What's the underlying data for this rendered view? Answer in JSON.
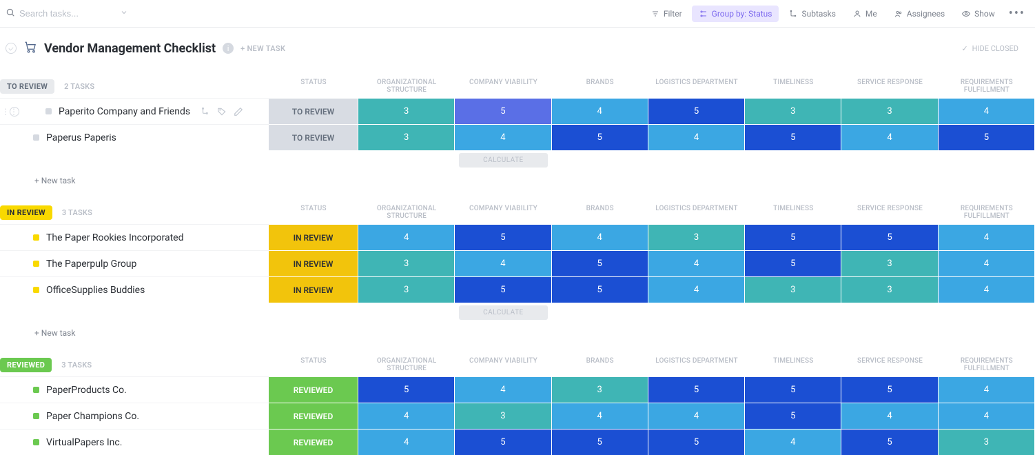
{
  "search": {
    "placeholder": "Search tasks..."
  },
  "toolbar": {
    "filter": "Filter",
    "group_by": "Group by: Status",
    "subtasks": "Subtasks",
    "me": "Me",
    "assignees": "Assignees",
    "show": "Show"
  },
  "list": {
    "title": "Vendor Management Checklist",
    "new_task_header": "+ NEW TASK",
    "hide_closed": "HIDE CLOSED"
  },
  "columns": {
    "status": "STATUS",
    "org": "ORGANIZATIONAL STRUCTURE",
    "viability": "COMPANY VIABILITY",
    "brands": "BRANDS",
    "logistics": "LOGISTICS DEPARTMENT",
    "timeliness": "TIMELINESS",
    "service": "SERVICE RESPONSE",
    "requirements": "REQUIREMENTS FULFILLMENT"
  },
  "calc_label": "CALCULATE",
  "new_task_label": "+ New task",
  "groups": [
    {
      "id": "to_review",
      "label": "TO REVIEW",
      "count": "2 TASKS",
      "pill_class": "pill-gray",
      "collapse_class": "",
      "status_class": "st-gray",
      "dot_class": "dot-gray",
      "show_calc": true,
      "show_new_task": true,
      "tasks": [
        {
          "name": "Paperito Company and Friends",
          "status": "TO REVIEW",
          "hover": true,
          "scores": [
            {
              "v": "3",
              "c": "c3"
            },
            {
              "v": "5",
              "c": "c5a"
            },
            {
              "v": "4",
              "c": "c4"
            },
            {
              "v": "5",
              "c": "c5b"
            },
            {
              "v": "3",
              "c": "c3"
            },
            {
              "v": "3",
              "c": "c3"
            },
            {
              "v": "4",
              "c": "c4"
            }
          ]
        },
        {
          "name": "Paperus Paperis",
          "status": "TO REVIEW",
          "scores": [
            {
              "v": "3",
              "c": "c3"
            },
            {
              "v": "4",
              "c": "c4"
            },
            {
              "v": "5",
              "c": "c5b"
            },
            {
              "v": "4",
              "c": "c4"
            },
            {
              "v": "5",
              "c": "c5b"
            },
            {
              "v": "4",
              "c": "c4"
            },
            {
              "v": "5",
              "c": "c5b"
            }
          ]
        }
      ]
    },
    {
      "id": "in_review",
      "label": "IN REVIEW",
      "count": "3 TASKS",
      "pill_class": "pill-yellow",
      "collapse_class": "yellow",
      "status_class": "st-yellow",
      "dot_class": "dot-yellow",
      "show_calc": true,
      "show_new_task": true,
      "tasks": [
        {
          "name": "The Paper Rookies Incorporated",
          "status": "IN REVIEW",
          "scores": [
            {
              "v": "4",
              "c": "c4"
            },
            {
              "v": "5",
              "c": "c5b"
            },
            {
              "v": "4",
              "c": "c4"
            },
            {
              "v": "3",
              "c": "c3"
            },
            {
              "v": "5",
              "c": "c5b"
            },
            {
              "v": "5",
              "c": "c5b"
            },
            {
              "v": "4",
              "c": "c4"
            }
          ]
        },
        {
          "name": "The Paperpulp Group",
          "status": "IN REVIEW",
          "scores": [
            {
              "v": "3",
              "c": "c3"
            },
            {
              "v": "4",
              "c": "c4"
            },
            {
              "v": "5",
              "c": "c5b"
            },
            {
              "v": "4",
              "c": "c4"
            },
            {
              "v": "5",
              "c": "c5b"
            },
            {
              "v": "3",
              "c": "c3"
            },
            {
              "v": "4",
              "c": "c4"
            }
          ]
        },
        {
          "name": "OfficeSupplies Buddies",
          "status": "IN REVIEW",
          "scores": [
            {
              "v": "3",
              "c": "c3"
            },
            {
              "v": "5",
              "c": "c5b"
            },
            {
              "v": "5",
              "c": "c5b"
            },
            {
              "v": "4",
              "c": "c4"
            },
            {
              "v": "3",
              "c": "c3"
            },
            {
              "v": "3",
              "c": "c3"
            },
            {
              "v": "4",
              "c": "c4"
            }
          ]
        }
      ]
    },
    {
      "id": "reviewed",
      "label": "REVIEWED",
      "count": "3 TASKS",
      "pill_class": "pill-green",
      "collapse_class": "green",
      "status_class": "st-green",
      "dot_class": "dot-green",
      "show_calc": false,
      "show_new_task": false,
      "tasks": [
        {
          "name": "PaperProducts Co.",
          "status": "REVIEWED",
          "scores": [
            {
              "v": "5",
              "c": "c5b"
            },
            {
              "v": "4",
              "c": "c4"
            },
            {
              "v": "3",
              "c": "c3"
            },
            {
              "v": "5",
              "c": "c5b"
            },
            {
              "v": "5",
              "c": "c5b"
            },
            {
              "v": "5",
              "c": "c5b"
            },
            {
              "v": "4",
              "c": "c4"
            }
          ]
        },
        {
          "name": "Paper Champions Co.",
          "status": "REVIEWED",
          "scores": [
            {
              "v": "4",
              "c": "c4"
            },
            {
              "v": "3",
              "c": "c3"
            },
            {
              "v": "4",
              "c": "c4"
            },
            {
              "v": "4",
              "c": "c4"
            },
            {
              "v": "5",
              "c": "c5b"
            },
            {
              "v": "4",
              "c": "c4"
            },
            {
              "v": "4",
              "c": "c4"
            }
          ]
        },
        {
          "name": "VirtualPapers Inc.",
          "status": "REVIEWED",
          "scores": [
            {
              "v": "4",
              "c": "c4"
            },
            {
              "v": "5",
              "c": "c5b"
            },
            {
              "v": "5",
              "c": "c5b"
            },
            {
              "v": "5",
              "c": "c5b"
            },
            {
              "v": "4",
              "c": "c4"
            },
            {
              "v": "5",
              "c": "c5b"
            },
            {
              "v": "3",
              "c": "c3"
            }
          ]
        }
      ]
    }
  ]
}
